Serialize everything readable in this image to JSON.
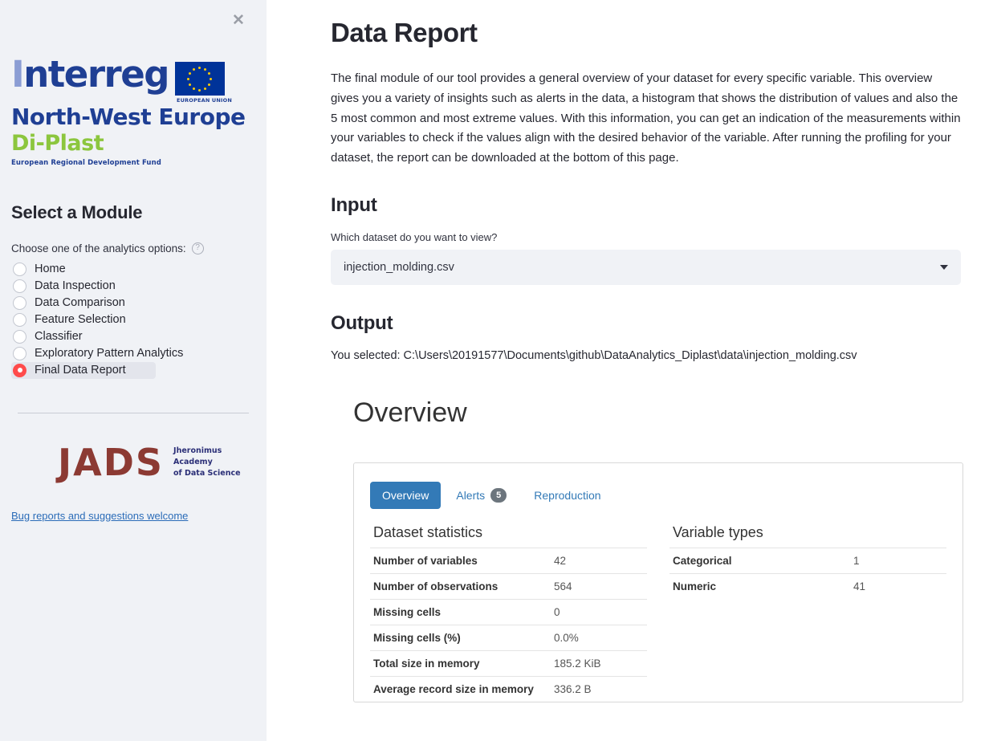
{
  "sidebar": {
    "close_icon": "close-icon",
    "logo": {
      "interreg": "Interreg",
      "interreg_sub": "North-West Europe",
      "brand": "Di-Plast",
      "fund_line": "European Regional Development Fund",
      "eu_label": "EUROPEAN UNION"
    },
    "heading": "Select a Module",
    "choose_label": "Choose one of the analytics options:",
    "help_icon": "help-circle-icon",
    "options": [
      {
        "label": "Home",
        "selected": false
      },
      {
        "label": "Data Inspection",
        "selected": false
      },
      {
        "label": "Data Comparison",
        "selected": false
      },
      {
        "label": "Feature Selection",
        "selected": false
      },
      {
        "label": "Classifier",
        "selected": false
      },
      {
        "label": "Exploratory Pattern Analytics",
        "selected": false
      },
      {
        "label": "Final Data Report",
        "selected": true
      }
    ],
    "jads": {
      "mark": "JADS",
      "line1": "Jheronimus",
      "line2": "Academy",
      "line3": "of Data Science"
    },
    "bug_link": "Bug reports and suggestions welcome"
  },
  "main": {
    "title": "Data Report",
    "intro": "The final module of our tool provides a general overview of your dataset for every specific variable. This overview gives you a variety of insights such as alerts in the data, a histogram that shows the distribution of values and also the 5 most common and most extreme values. With this information, you can get an indication of the measurements within your variables to check if the values align with the desired behavior of the variable. After running the profiling for your dataset, the report can be downloaded at the bottom of this page.",
    "input_heading": "Input",
    "dataset_question": "Which dataset do you want to view?",
    "dataset_selected": "injection_molding.csv",
    "dropdown_icon": "chevron-down-icon",
    "output_heading": "Output",
    "output_line": "You selected: C:\\Users\\20191577\\Documents\\github\\DataAnalytics_Diplast\\data\\injection_molding.csv"
  },
  "report": {
    "overview_title": "Overview",
    "tabs": [
      {
        "label": "Overview",
        "badge": null,
        "active": true
      },
      {
        "label": "Alerts",
        "badge": "5",
        "active": false
      },
      {
        "label": "Reproduction",
        "badge": null,
        "active": false
      }
    ],
    "dataset_statistics": {
      "title": "Dataset statistics",
      "rows": [
        {
          "label": "Number of variables",
          "value": "42"
        },
        {
          "label": "Number of observations",
          "value": "564"
        },
        {
          "label": "Missing cells",
          "value": "0"
        },
        {
          "label": "Missing cells (%)",
          "value": "0.0%"
        },
        {
          "label": "Total size in memory",
          "value": "185.2 KiB"
        },
        {
          "label": "Average record size in memory",
          "value": "336.2 B"
        }
      ]
    },
    "variable_types": {
      "title": "Variable types",
      "rows": [
        {
          "label": "Categorical",
          "value": "1"
        },
        {
          "label": "Numeric",
          "value": "41"
        }
      ]
    }
  },
  "colors": {
    "accent_red": "#ff4b4b",
    "tab_blue": "#337ab7",
    "badge_gray": "#6c757d",
    "sidebar_bg": "#f0f2f6",
    "interreg_blue": "#1f3f94",
    "diplast_green": "#8cc63e",
    "jads_maroon": "#8c3a33"
  }
}
